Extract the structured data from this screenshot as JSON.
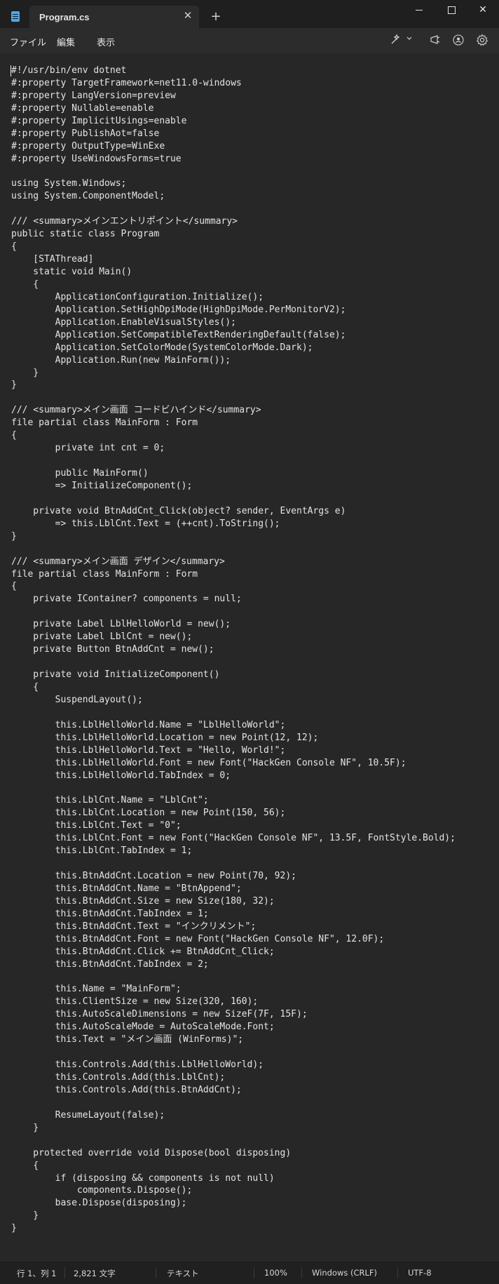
{
  "window": {
    "tab_title": "Program.cs",
    "close_glyph": "✕",
    "new_tab_glyph": "+"
  },
  "menu": {
    "file": "ファイル",
    "edit": "編集",
    "view": "表示"
  },
  "toolbar": {
    "icons": [
      "copilot-icon",
      "chevron-down-icon",
      "share-icon",
      "account-icon",
      "settings-icon"
    ]
  },
  "editor": {
    "lines": [
      "#!/usr/bin/env dotnet",
      "#:property TargetFramework=net11.0-windows",
      "#:property LangVersion=preview",
      "#:property Nullable=enable",
      "#:property ImplicitUsings=enable",
      "#:property PublishAot=false",
      "#:property OutputType=WinExe",
      "#:property UseWindowsForms=true",
      "",
      "using System.Windows;",
      "using System.ComponentModel;",
      "",
      "/// <summary>メインエントリポイント</summary>",
      "public static class Program",
      "{",
      "    [STAThread]",
      "    static void Main()",
      "    {",
      "        ApplicationConfiguration.Initialize();",
      "        Application.SetHighDpiMode(HighDpiMode.PerMonitorV2);",
      "        Application.EnableVisualStyles();",
      "        Application.SetCompatibleTextRenderingDefault(false);",
      "        Application.SetColorMode(SystemColorMode.Dark);",
      "        Application.Run(new MainForm());",
      "    }",
      "}",
      "",
      "/// <summary>メイン画面 コードビハインド</summary>",
      "file partial class MainForm : Form",
      "{",
      "        private int cnt = 0;",
      "",
      "        public MainForm()",
      "        => InitializeComponent();",
      "",
      "    private void BtnAddCnt_Click(object? sender, EventArgs e)",
      "        => this.LblCnt.Text = (++cnt).ToString();",
      "}",
      "",
      "/// <summary>メイン画面 デザイン</summary>",
      "file partial class MainForm : Form",
      "{",
      "    private IContainer? components = null;",
      "",
      "    private Label LblHelloWorld = new();",
      "    private Label LblCnt = new();",
      "    private Button BtnAddCnt = new();",
      "",
      "    private void InitializeComponent()",
      "    {",
      "        SuspendLayout();",
      "",
      "        this.LblHelloWorld.Name = \"LblHelloWorld\";",
      "        this.LblHelloWorld.Location = new Point(12, 12);",
      "        this.LblHelloWorld.Text = \"Hello, World!\";",
      "        this.LblHelloWorld.Font = new Font(\"HackGen Console NF\", 10.5F);",
      "        this.LblHelloWorld.TabIndex = 0;",
      "",
      "        this.LblCnt.Name = \"LblCnt\";",
      "        this.LblCnt.Location = new Point(150, 56);",
      "        this.LblCnt.Text = \"0\";",
      "        this.LblCnt.Font = new Font(\"HackGen Console NF\", 13.5F, FontStyle.Bold);",
      "        this.LblCnt.TabIndex = 1;",
      "",
      "        this.BtnAddCnt.Location = new Point(70, 92);",
      "        this.BtnAddCnt.Name = \"BtnAppend\";",
      "        this.BtnAddCnt.Size = new Size(180, 32);",
      "        this.BtnAddCnt.TabIndex = 1;",
      "        this.BtnAddCnt.Text = \"インクリメント\";",
      "        this.BtnAddCnt.Font = new Font(\"HackGen Console NF\", 12.0F);",
      "        this.BtnAddCnt.Click += BtnAddCnt_Click;",
      "        this.BtnAddCnt.TabIndex = 2;",
      "",
      "        this.Name = \"MainForm\";",
      "        this.ClientSize = new Size(320, 160);",
      "        this.AutoScaleDimensions = new SizeF(7F, 15F);",
      "        this.AutoScaleMode = AutoScaleMode.Font;",
      "        this.Text = \"メイン画面 (WinForms)\";",
      "",
      "        this.Controls.Add(this.LblHelloWorld);",
      "        this.Controls.Add(this.LblCnt);",
      "        this.Controls.Add(this.BtnAddCnt);",
      "",
      "        ResumeLayout(false);",
      "    }",
      "",
      "    protected override void Dispose(bool disposing)",
      "    {",
      "        if (disposing && components is not null)",
      "            components.Dispose();",
      "        base.Dispose(disposing);",
      "    }",
      "}"
    ]
  },
  "status": {
    "position": "行 1、列 1",
    "char_count": "2,821 文字",
    "mode": "テキスト",
    "zoom": "100%",
    "line_ending": "Windows (CRLF)",
    "encoding": "UTF-8"
  },
  "colors": {
    "background": "#272727",
    "titlebar": "#1f1f1f",
    "text": "#e4e4e4",
    "app_icon": "#4aa8f0"
  }
}
